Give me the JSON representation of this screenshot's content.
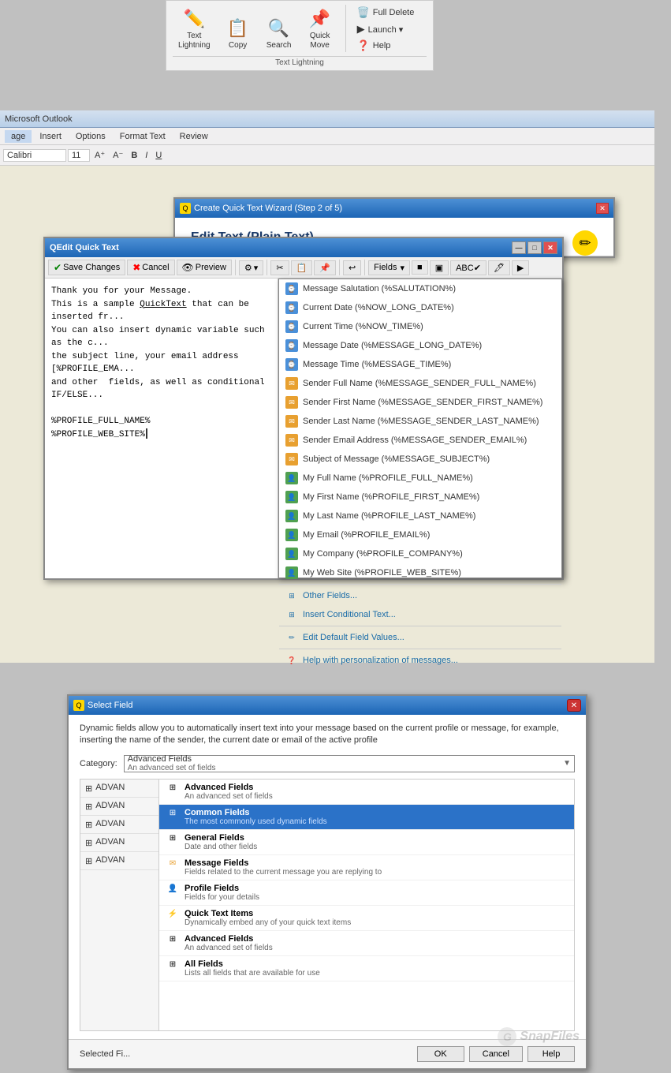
{
  "ribbon": {
    "title": "Text Lightning",
    "buttons": [
      {
        "id": "text-lightning",
        "label": "Text\nLightning",
        "icon": "✏️"
      },
      {
        "id": "copy",
        "label": "Copy",
        "icon": "📋",
        "has_arrow": true
      },
      {
        "id": "search",
        "label": "Search",
        "icon": "🔍"
      },
      {
        "id": "quick-move",
        "label": "Quick\nMove",
        "icon": "📌"
      }
    ],
    "side_buttons": [
      {
        "id": "full-delete",
        "label": "Full Delete",
        "icon": "🗑️"
      },
      {
        "id": "launch",
        "label": "Launch ▾",
        "icon": ""
      },
      {
        "id": "help",
        "label": "Help",
        "icon": "❓"
      }
    ],
    "group_label": "Text Lightning"
  },
  "word": {
    "menu_items": [
      "age",
      "Insert",
      "Options",
      "Format Text",
      "Review"
    ],
    "active_menu": "age"
  },
  "edit_qt_dialog": {
    "title": "Edit Quick Text",
    "title_icon": "Q",
    "toolbar_buttons": [
      {
        "id": "save-changes",
        "label": "Save Changes",
        "icon": "✔"
      },
      {
        "id": "cancel",
        "label": "Cancel",
        "icon": "✖"
      },
      {
        "id": "preview",
        "label": "Preview",
        "icon": "👁"
      }
    ],
    "text_content": "Thank you for your Message.\nThis is a sample QuickText that can be inserted fr...\nYou can also insert dynamic variable such as the c...\nthe subject line, your email address [%PROFILE_EMA...\nand other  fields, as well as conditional IF/ELSE...\n\n%PROFILE_FULL_NAME%\n%PROFILE_WEB_SITE%",
    "fields_btn_label": "Fields"
  },
  "fields_dropdown": {
    "items": [
      {
        "id": "msg-salutation",
        "label": "Message Salutation (%SALUTATION%)",
        "icon_type": "blue"
      },
      {
        "id": "current-date",
        "label": "Current Date (%NOW_LONG_DATE%)",
        "icon_type": "blue"
      },
      {
        "id": "current-time",
        "label": "Current Time (%NOW_TIME%)",
        "icon_type": "blue"
      },
      {
        "id": "message-date",
        "label": "Message Date (%MESSAGE_LONG_DATE%)",
        "icon_type": "blue"
      },
      {
        "id": "message-time",
        "label": "Message Time (%MESSAGE_TIME%)",
        "icon_type": "blue"
      },
      {
        "id": "sender-full-name",
        "label": "Sender Full Name (%MESSAGE_SENDER_FULL_NAME%)",
        "icon_type": "orange"
      },
      {
        "id": "sender-first-name",
        "label": "Sender First Name (%MESSAGE_SENDER_FIRST_NAME%)",
        "icon_type": "orange"
      },
      {
        "id": "sender-last-name",
        "label": "Sender Last Name (%MESSAGE_SENDER_LAST_NAME%)",
        "icon_type": "orange"
      },
      {
        "id": "sender-email",
        "label": "Sender Email Address (%MESSAGE_SENDER_EMAIL%)",
        "icon_type": "orange"
      },
      {
        "id": "subject",
        "label": "Subject of Message (%MESSAGE_SUBJECT%)",
        "icon_type": "orange"
      },
      {
        "id": "my-full-name",
        "label": "My Full Name (%PROFILE_FULL_NAME%)",
        "icon_type": "green"
      },
      {
        "id": "my-first-name",
        "label": "My First Name (%PROFILE_FIRST_NAME%)",
        "icon_type": "green"
      },
      {
        "id": "my-last-name",
        "label": "My Last Name (%PROFILE_LAST_NAME%)",
        "icon_type": "green"
      },
      {
        "id": "my-email",
        "label": "My Email (%PROFILE_EMAIL%)",
        "icon_type": "green"
      },
      {
        "id": "my-company",
        "label": "My Company (%PROFILE_COMPANY%)",
        "icon_type": "green"
      },
      {
        "id": "my-website",
        "label": "My Web Site (%PROFILE_WEB_SITE%)",
        "icon_type": "green"
      }
    ],
    "action_items": [
      {
        "id": "other-fields",
        "label": "Other Fields..."
      },
      {
        "id": "insert-conditional",
        "label": "Insert Conditional Text..."
      },
      {
        "id": "edit-default",
        "label": "Edit Default Field Values..."
      },
      {
        "id": "help-personalization",
        "label": "Help with personalization of messages..."
      }
    ]
  },
  "wizard": {
    "title": "Create Quick Text Wizard (Step 2 of 5)",
    "title_icon": "Q",
    "heading": "Edit Text (Plain Text)",
    "help_icon": "?"
  },
  "select_field": {
    "title": "Select Field",
    "title_icon": "Q",
    "description": "Dynamic fields allow you to automatically insert text into your message based on the current profile or message, for example, inserting the name of the sender, the current date or email of the active profile",
    "category_label": "Category:",
    "selected_category_name": "Advanced Fields",
    "selected_category_desc": "An advanced set of fields",
    "left_items": [
      {
        "id": "adv1",
        "label": "ADVAN"
      },
      {
        "id": "adv2",
        "label": "ADVAN"
      },
      {
        "id": "adv3",
        "label": "ADVAN"
      },
      {
        "id": "adv4",
        "label": "ADVAN"
      },
      {
        "id": "adv5",
        "label": "ADVAN"
      }
    ],
    "dropdown_options": [
      {
        "id": "advanced-fields",
        "name": "Advanced Fields",
        "desc": "An advanced set of fields",
        "highlighted": false
      },
      {
        "id": "common-fields",
        "name": "Common Fields",
        "desc": "The most commonly used dynamic fields",
        "highlighted": true
      },
      {
        "id": "general-fields",
        "name": "General Fields",
        "desc": "Date and other fields",
        "highlighted": false
      },
      {
        "id": "message-fields",
        "name": "Message Fields",
        "desc": "Fields related to the current message you are replying to",
        "highlighted": false
      },
      {
        "id": "profile-fields",
        "name": "Profile Fields",
        "desc": "Fields for your details",
        "highlighted": false
      },
      {
        "id": "quick-text-items",
        "name": "Quick Text Items",
        "desc": "Dynamically embed any of your quick text items",
        "highlighted": false
      },
      {
        "id": "advanced-fields-2",
        "name": "Advanced Fields",
        "desc": "An advanced set of fields",
        "highlighted": false
      },
      {
        "id": "all-fields",
        "name": "All Fields",
        "desc": "Lists all fields that are available for use",
        "highlighted": false
      }
    ],
    "selected_field_label": "Selected Fi...",
    "footer_buttons": [
      {
        "id": "ok",
        "label": "OK"
      },
      {
        "id": "cancel",
        "label": "Cancel"
      },
      {
        "id": "help",
        "label": "Help"
      }
    ]
  }
}
